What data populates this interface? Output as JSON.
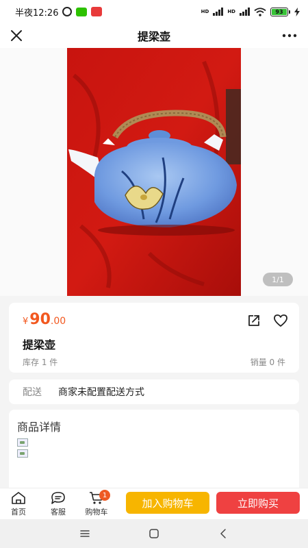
{
  "status_bar": {
    "time": "半夜12:26",
    "network_left": "HD",
    "network_right": "HD",
    "battery": "93"
  },
  "title_bar": {
    "title": "提梁壶"
  },
  "gallery": {
    "page_indicator": "1/1"
  },
  "product": {
    "currency": "¥",
    "price_int": "90",
    "price_dec": ".00",
    "name": "提梁壶",
    "stock": "库存 1 件",
    "sales": "销量 0 件"
  },
  "shipping": {
    "label": "配送",
    "value": "商家未配置配送方式"
  },
  "detail": {
    "title": "商品详情"
  },
  "action_bar": {
    "home": "首页",
    "service": "客服",
    "cart": "购物车",
    "cart_badge": "1",
    "add_to_cart": "加入购物车",
    "buy_now": "立即购买"
  },
  "colors": {
    "price": "#f2581f",
    "add_to_cart_bg": "#f7b500",
    "buy_now_bg": "#ef4141",
    "badge": "#ee5a24"
  },
  "icons": {
    "close": "close-icon",
    "more": "more-icon",
    "share": "share-icon",
    "favorite": "heart-icon",
    "home": "home-icon",
    "service": "chat-icon",
    "cart": "cart-icon"
  }
}
